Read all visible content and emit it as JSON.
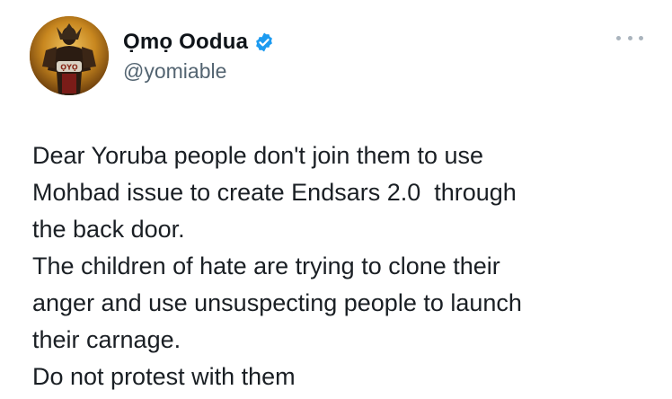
{
  "tweet": {
    "author": {
      "display_name": "Ọmọ Oodua",
      "handle": "@yomiable",
      "verified": true,
      "verified_color": "#1d9bf0"
    },
    "more_icon": "more-dots-icon",
    "lines": [
      "Dear Yoruba people don't join them to use",
      "Mohbad issue to create Endsars 2.0  through",
      "the back door.",
      "The children of hate are trying to clone their",
      "anger and use unsuspecting people to launch",
      "their carnage.",
      "Do not protest with them"
    ]
  },
  "colors": {
    "text": "#0f1419",
    "secondary": "#536471",
    "accent": "#1d9bf0"
  }
}
